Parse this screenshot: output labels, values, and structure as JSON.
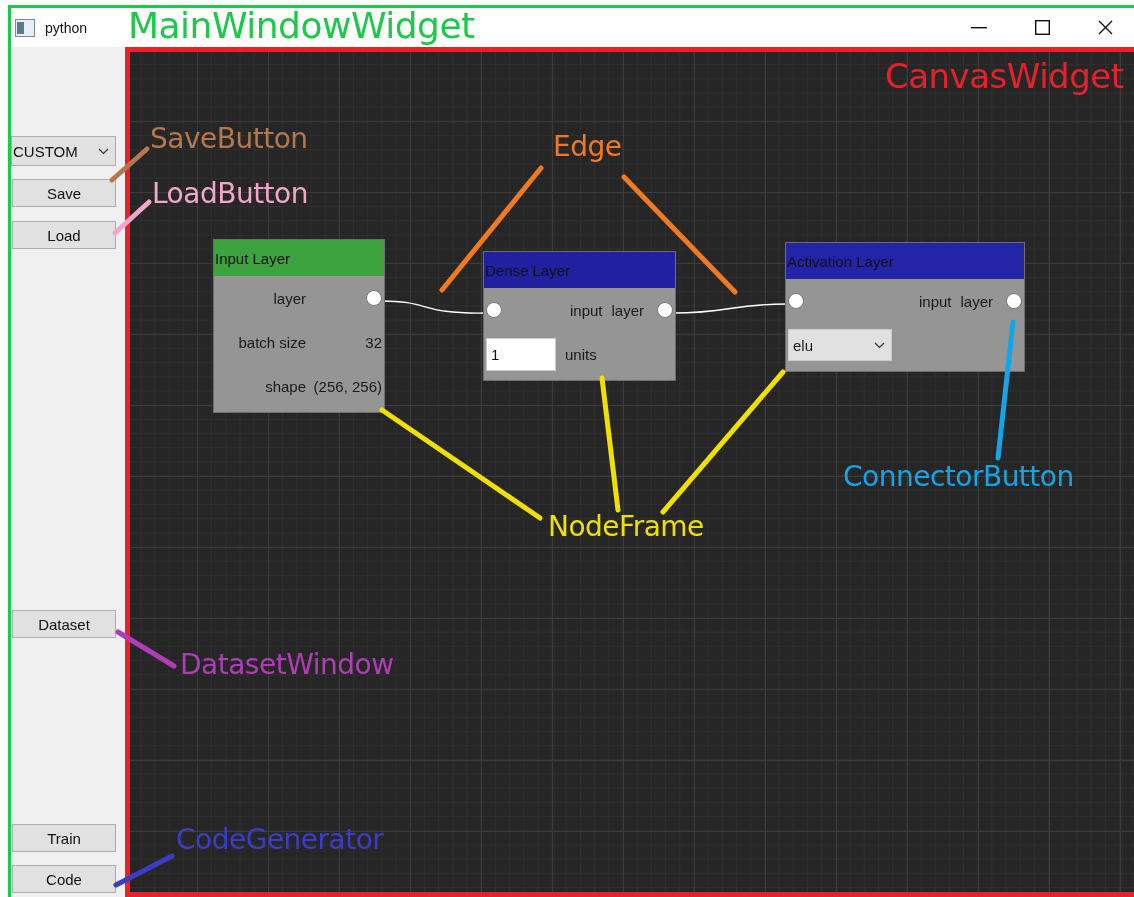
{
  "window": {
    "title": "python"
  },
  "sidebar": {
    "items": [
      {
        "kind": "dropdown",
        "value": "CUSTOM"
      },
      {
        "kind": "button",
        "label": "Save"
      },
      {
        "kind": "button",
        "label": "Load"
      },
      {
        "kind": "button",
        "label": "Dataset"
      },
      {
        "kind": "button",
        "label": "Train"
      },
      {
        "kind": "button",
        "label": "Code"
      }
    ]
  },
  "canvas": {
    "nodes": [
      {
        "title": "Input Layer",
        "color": "#3da33f",
        "rows": [
          {
            "kind": "output",
            "label": "layer"
          },
          {
            "kind": "value",
            "label": "batch size",
            "value": "32"
          },
          {
            "kind": "value",
            "label": "shape",
            "value": "(256, 256)"
          }
        ]
      },
      {
        "title": "Dense Layer",
        "color": "#2020a0",
        "rows": [
          {
            "kind": "io",
            "input_label": "input",
            "output_label": "layer"
          },
          {
            "kind": "number_field",
            "value": "1",
            "label": "units"
          }
        ]
      },
      {
        "title": "Activation Layer",
        "color": "#2424a8",
        "rows": [
          {
            "kind": "io",
            "input_label": "input",
            "output_label": "layer"
          },
          {
            "kind": "dropdown",
            "value": "elu"
          }
        ]
      }
    ]
  },
  "annotations": [
    {
      "text": "MainWindowWidget",
      "color": "#1ec84a"
    },
    {
      "text": "CanvasWidget",
      "color": "#e8202a"
    },
    {
      "text": "SaveButton",
      "color": "#b5784e"
    },
    {
      "text": "LoadButton",
      "color": "#f4a6c8"
    },
    {
      "text": "Edge",
      "color": "#f07a22"
    },
    {
      "text": "NodeFrame",
      "color": "#f0e000"
    },
    {
      "text": "ConnectorButton",
      "color": "#12a6e8"
    },
    {
      "text": "DatasetWindow",
      "color": "#b03cb8"
    },
    {
      "text": "CodeGenerator",
      "color": "#3c3cc8"
    }
  ]
}
